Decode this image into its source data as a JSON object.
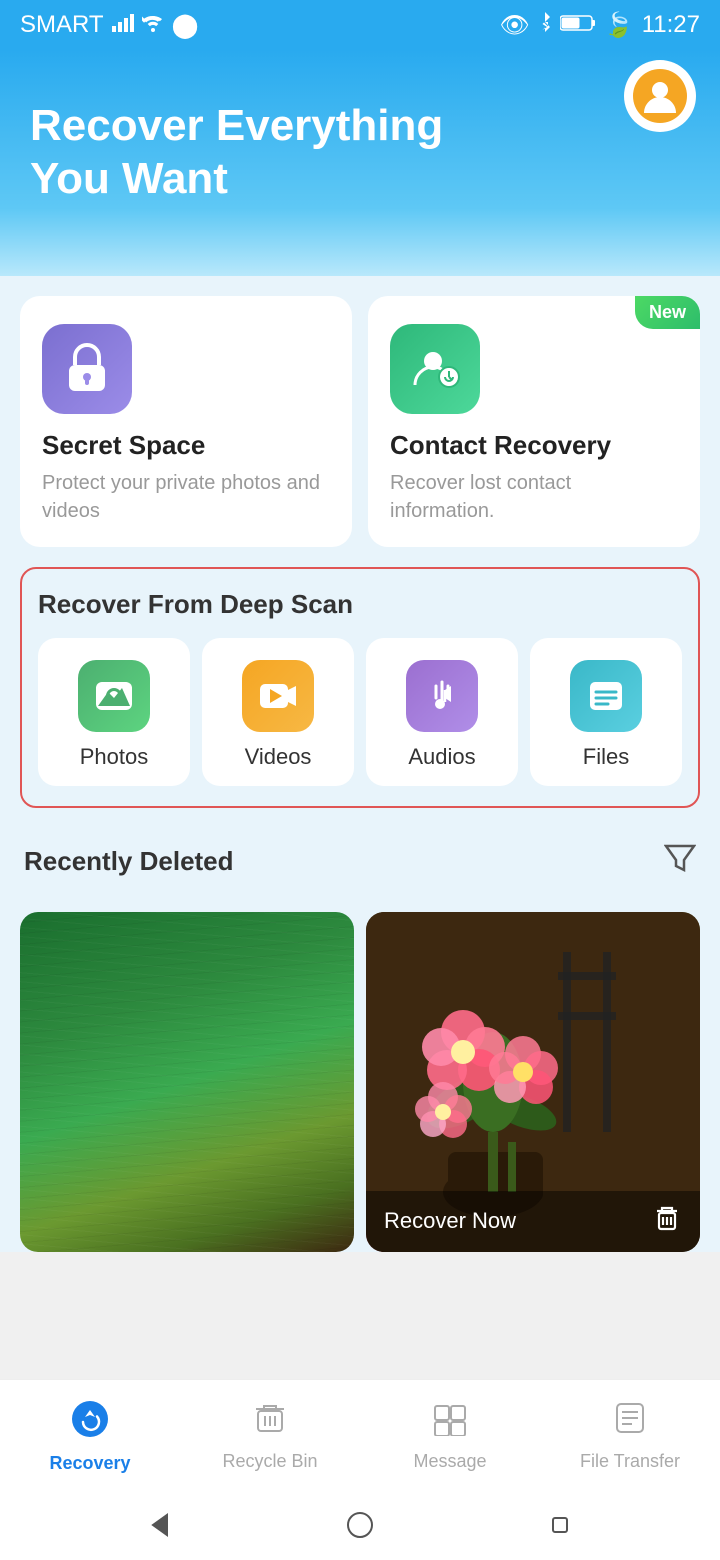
{
  "statusBar": {
    "carrier": "SMART",
    "time": "11:27",
    "batteryLevel": "52"
  },
  "header": {
    "title": "Recover Everything\nYou Want",
    "avatarLabel": "User Profile"
  },
  "featureCards": [
    {
      "id": "secret-space",
      "title": "Secret Space",
      "description": "Protect your private photos and videos",
      "isNew": false
    },
    {
      "id": "contact-recovery",
      "title": "Contact Recovery",
      "description": "Recover lost contact information.",
      "isNew": true,
      "badgeText": "New"
    }
  ],
  "deepScan": {
    "title": "Recover From Deep Scan",
    "items": [
      {
        "id": "photos",
        "label": "Photos"
      },
      {
        "id": "videos",
        "label": "Videos"
      },
      {
        "id": "audios",
        "label": "Audios"
      },
      {
        "id": "files",
        "label": "Files"
      }
    ]
  },
  "recentlyDeleted": {
    "title": "Recently Deleted"
  },
  "recoverNow": {
    "label": "Recover Now"
  },
  "bottomNav": {
    "items": [
      {
        "id": "recovery",
        "label": "Recovery",
        "active": true
      },
      {
        "id": "recycle-bin",
        "label": "Recycle Bin",
        "active": false
      },
      {
        "id": "message",
        "label": "Message",
        "active": false
      },
      {
        "id": "file-transfer",
        "label": "File Transfer",
        "active": false
      }
    ]
  }
}
